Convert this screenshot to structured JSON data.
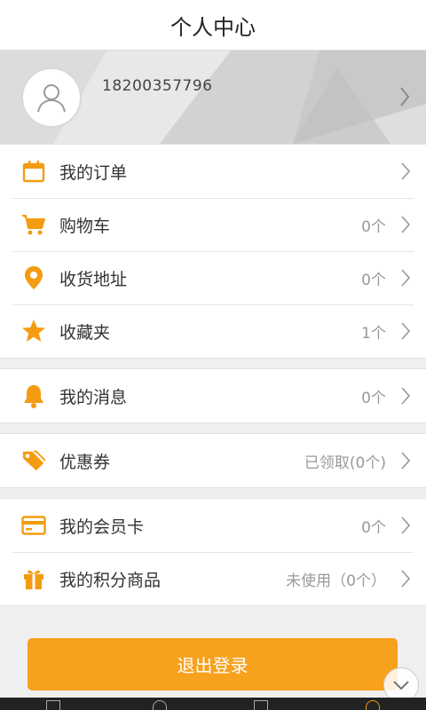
{
  "header": {
    "title": "个人中心"
  },
  "profile": {
    "phone": "18200357796",
    "avatar_icon": "user-avatar-icon"
  },
  "groups": [
    {
      "rows": [
        {
          "label": "我的订单",
          "value": "",
          "icon": "calendar-icon"
        },
        {
          "label": "购物车",
          "value": "0个",
          "icon": "cart-icon"
        },
        {
          "label": "收货地址",
          "value": "0个",
          "icon": "location-pin-icon"
        },
        {
          "label": "收藏夹",
          "value": "1个",
          "icon": "star-icon"
        }
      ]
    },
    {
      "rows": [
        {
          "label": "我的消息",
          "value": "0个",
          "icon": "bell-icon"
        }
      ]
    },
    {
      "rows": [
        {
          "label": "优惠券",
          "value": "已领取(0个)",
          "icon": "tag-icon"
        }
      ]
    },
    {
      "rows": [
        {
          "label": "我的会员卡",
          "value": "0个",
          "icon": "card-icon"
        },
        {
          "label": "我的积分商品",
          "value": "未使用（0个）",
          "icon": "gift-icon"
        }
      ]
    }
  ],
  "logout": {
    "label": "退出登录"
  },
  "colors": {
    "accent": "#f7a11d",
    "icon": "#f39c12"
  }
}
